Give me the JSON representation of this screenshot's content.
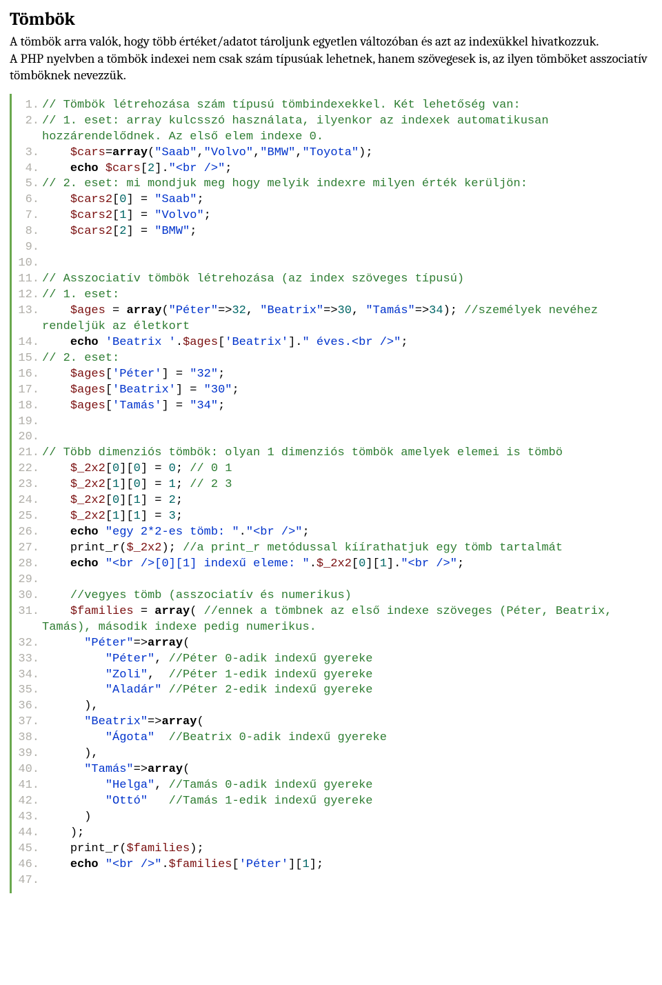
{
  "title": "Tömbök",
  "intro": [
    "A tömbök arra valók, hogy több értéket/adatot tároljunk egyetlen változóban és azt az indexükkel hivatkozzuk.",
    "A PHP nyelvben a tömbök indexei nem csak szám típusúak lehetnek, hanem szövegesek is, az ilyen tömböket asszociatív tömböknek nevezzük."
  ],
  "code": [
    {
      "n": "1.",
      "tokens": [
        {
          "c": "comment",
          "t": "// Tömbök létrehozása szám típusú tömbindexekkel. Két lehetőség van:"
        }
      ]
    },
    {
      "n": "2.",
      "tokens": [
        {
          "c": "comment",
          "t": "// 1. eset: array kulcsszó használata, ilyenkor az indexek automatikusan hozzárendelődnek. Az első elem indexe 0."
        }
      ]
    },
    {
      "n": "3.",
      "tokens": [
        {
          "c": "plain",
          "t": "    "
        },
        {
          "c": "var",
          "t": "$cars"
        },
        {
          "c": "op",
          "t": "="
        },
        {
          "c": "func",
          "t": "array"
        },
        {
          "c": "plain",
          "t": "("
        },
        {
          "c": "str",
          "t": "\"Saab\""
        },
        {
          "c": "plain",
          "t": ","
        },
        {
          "c": "str",
          "t": "\"Volvo\""
        },
        {
          "c": "plain",
          "t": ","
        },
        {
          "c": "str",
          "t": "\"BMW\""
        },
        {
          "c": "plain",
          "t": ","
        },
        {
          "c": "str",
          "t": "\"Toyota\""
        },
        {
          "c": "plain",
          "t": ");"
        }
      ]
    },
    {
      "n": "4.",
      "tokens": [
        {
          "c": "plain",
          "t": "    "
        },
        {
          "c": "keyword",
          "t": "echo"
        },
        {
          "c": "plain",
          "t": " "
        },
        {
          "c": "var",
          "t": "$cars"
        },
        {
          "c": "plain",
          "t": "["
        },
        {
          "c": "num",
          "t": "2"
        },
        {
          "c": "plain",
          "t": "]."
        },
        {
          "c": "str",
          "t": "\"<br />\""
        },
        {
          "c": "plain",
          "t": ";"
        }
      ]
    },
    {
      "n": "5.",
      "tokens": [
        {
          "c": "comment",
          "t": "// 2. eset: mi mondjuk meg hogy melyik indexre milyen érték kerüljön:"
        }
      ]
    },
    {
      "n": "6.",
      "tokens": [
        {
          "c": "plain",
          "t": "    "
        },
        {
          "c": "var",
          "t": "$cars2"
        },
        {
          "c": "plain",
          "t": "["
        },
        {
          "c": "num",
          "t": "0"
        },
        {
          "c": "plain",
          "t": "] = "
        },
        {
          "c": "str",
          "t": "\"Saab\""
        },
        {
          "c": "plain",
          "t": ";"
        }
      ]
    },
    {
      "n": "7.",
      "tokens": [
        {
          "c": "plain",
          "t": "    "
        },
        {
          "c": "var",
          "t": "$cars2"
        },
        {
          "c": "plain",
          "t": "["
        },
        {
          "c": "num",
          "t": "1"
        },
        {
          "c": "plain",
          "t": "] = "
        },
        {
          "c": "str",
          "t": "\"Volvo\""
        },
        {
          "c": "plain",
          "t": ";"
        }
      ]
    },
    {
      "n": "8.",
      "tokens": [
        {
          "c": "plain",
          "t": "    "
        },
        {
          "c": "var",
          "t": "$cars2"
        },
        {
          "c": "plain",
          "t": "["
        },
        {
          "c": "num",
          "t": "2"
        },
        {
          "c": "plain",
          "t": "] = "
        },
        {
          "c": "str",
          "t": "\"BMW\""
        },
        {
          "c": "plain",
          "t": ";"
        }
      ]
    },
    {
      "n": "9.",
      "tokens": [
        {
          "c": "plain",
          "t": " "
        }
      ]
    },
    {
      "n": "10.",
      "tokens": [
        {
          "c": "plain",
          "t": " "
        }
      ]
    },
    {
      "n": "11.",
      "tokens": [
        {
          "c": "comment",
          "t": "// Asszociatív tömbök létrehozása (az index szöveges típusú)"
        }
      ]
    },
    {
      "n": "12.",
      "tokens": [
        {
          "c": "comment",
          "t": "// 1. eset:"
        }
      ]
    },
    {
      "n": "13.",
      "tokens": [
        {
          "c": "plain",
          "t": "    "
        },
        {
          "c": "var",
          "t": "$ages"
        },
        {
          "c": "plain",
          "t": " = "
        },
        {
          "c": "func",
          "t": "array"
        },
        {
          "c": "plain",
          "t": "("
        },
        {
          "c": "str",
          "t": "\"Péter\""
        },
        {
          "c": "plain",
          "t": "=>"
        },
        {
          "c": "num",
          "t": "32"
        },
        {
          "c": "plain",
          "t": ", "
        },
        {
          "c": "str",
          "t": "\"Beatrix\""
        },
        {
          "c": "plain",
          "t": "=>"
        },
        {
          "c": "num",
          "t": "30"
        },
        {
          "c": "plain",
          "t": ", "
        },
        {
          "c": "str",
          "t": "\"Tamás\""
        },
        {
          "c": "plain",
          "t": "=>"
        },
        {
          "c": "num",
          "t": "34"
        },
        {
          "c": "plain",
          "t": "); "
        },
        {
          "c": "comment",
          "t": "//személyek nevéhez rendeljük az életkort"
        }
      ]
    },
    {
      "n": "14.",
      "tokens": [
        {
          "c": "plain",
          "t": "    "
        },
        {
          "c": "keyword",
          "t": "echo"
        },
        {
          "c": "plain",
          "t": " "
        },
        {
          "c": "str",
          "t": "'Beatrix '"
        },
        {
          "c": "plain",
          "t": "."
        },
        {
          "c": "var",
          "t": "$ages"
        },
        {
          "c": "plain",
          "t": "["
        },
        {
          "c": "str",
          "t": "'Beatrix'"
        },
        {
          "c": "plain",
          "t": "]."
        },
        {
          "c": "str",
          "t": "\" éves.<br />\""
        },
        {
          "c": "plain",
          "t": ";"
        }
      ]
    },
    {
      "n": "15.",
      "tokens": [
        {
          "c": "comment",
          "t": "// 2. eset:"
        }
      ]
    },
    {
      "n": "16.",
      "tokens": [
        {
          "c": "plain",
          "t": "    "
        },
        {
          "c": "var",
          "t": "$ages"
        },
        {
          "c": "plain",
          "t": "["
        },
        {
          "c": "str",
          "t": "'Péter'"
        },
        {
          "c": "plain",
          "t": "] = "
        },
        {
          "c": "str",
          "t": "\"32\""
        },
        {
          "c": "plain",
          "t": ";"
        }
      ]
    },
    {
      "n": "17.",
      "tokens": [
        {
          "c": "plain",
          "t": "    "
        },
        {
          "c": "var",
          "t": "$ages"
        },
        {
          "c": "plain",
          "t": "["
        },
        {
          "c": "str",
          "t": "'Beatrix'"
        },
        {
          "c": "plain",
          "t": "] = "
        },
        {
          "c": "str",
          "t": "\"30\""
        },
        {
          "c": "plain",
          "t": ";"
        }
      ]
    },
    {
      "n": "18.",
      "tokens": [
        {
          "c": "plain",
          "t": "    "
        },
        {
          "c": "var",
          "t": "$ages"
        },
        {
          "c": "plain",
          "t": "["
        },
        {
          "c": "str",
          "t": "'Tamás'"
        },
        {
          "c": "plain",
          "t": "] = "
        },
        {
          "c": "str",
          "t": "\"34\""
        },
        {
          "c": "plain",
          "t": ";"
        }
      ]
    },
    {
      "n": "19.",
      "tokens": [
        {
          "c": "plain",
          "t": " "
        }
      ]
    },
    {
      "n": "20.",
      "tokens": [
        {
          "c": "plain",
          "t": " "
        }
      ]
    },
    {
      "n": "21.",
      "tokens": [
        {
          "c": "comment",
          "t": "// Több dimenziós tömbök: olyan 1 dimenziós tömbök amelyek elemei is tömbö"
        }
      ]
    },
    {
      "n": "22.",
      "tokens": [
        {
          "c": "plain",
          "t": "    "
        },
        {
          "c": "var",
          "t": "$_2x2"
        },
        {
          "c": "plain",
          "t": "["
        },
        {
          "c": "num",
          "t": "0"
        },
        {
          "c": "plain",
          "t": "]["
        },
        {
          "c": "num",
          "t": "0"
        },
        {
          "c": "plain",
          "t": "] = "
        },
        {
          "c": "num",
          "t": "0"
        },
        {
          "c": "plain",
          "t": "; "
        },
        {
          "c": "comment",
          "t": "// 0 1"
        }
      ]
    },
    {
      "n": "23.",
      "tokens": [
        {
          "c": "plain",
          "t": "    "
        },
        {
          "c": "var",
          "t": "$_2x2"
        },
        {
          "c": "plain",
          "t": "["
        },
        {
          "c": "num",
          "t": "1"
        },
        {
          "c": "plain",
          "t": "]["
        },
        {
          "c": "num",
          "t": "0"
        },
        {
          "c": "plain",
          "t": "] = "
        },
        {
          "c": "num",
          "t": "1"
        },
        {
          "c": "plain",
          "t": "; "
        },
        {
          "c": "comment",
          "t": "// 2 3"
        }
      ]
    },
    {
      "n": "24.",
      "tokens": [
        {
          "c": "plain",
          "t": "    "
        },
        {
          "c": "var",
          "t": "$_2x2"
        },
        {
          "c": "plain",
          "t": "["
        },
        {
          "c": "num",
          "t": "0"
        },
        {
          "c": "plain",
          "t": "]["
        },
        {
          "c": "num",
          "t": "1"
        },
        {
          "c": "plain",
          "t": "] = "
        },
        {
          "c": "num",
          "t": "2"
        },
        {
          "c": "plain",
          "t": ";"
        }
      ]
    },
    {
      "n": "25.",
      "tokens": [
        {
          "c": "plain",
          "t": "    "
        },
        {
          "c": "var",
          "t": "$_2x2"
        },
        {
          "c": "plain",
          "t": "["
        },
        {
          "c": "num",
          "t": "1"
        },
        {
          "c": "plain",
          "t": "]["
        },
        {
          "c": "num",
          "t": "1"
        },
        {
          "c": "plain",
          "t": "] = "
        },
        {
          "c": "num",
          "t": "3"
        },
        {
          "c": "plain",
          "t": ";"
        }
      ]
    },
    {
      "n": "26.",
      "tokens": [
        {
          "c": "plain",
          "t": "    "
        },
        {
          "c": "keyword",
          "t": "echo"
        },
        {
          "c": "plain",
          "t": " "
        },
        {
          "c": "str",
          "t": "\"egy 2*2-es tömb: \""
        },
        {
          "c": "plain",
          "t": "."
        },
        {
          "c": "str",
          "t": "\"<br />\""
        },
        {
          "c": "plain",
          "t": ";"
        }
      ]
    },
    {
      "n": "27.",
      "tokens": [
        {
          "c": "plain",
          "t": "    print_r("
        },
        {
          "c": "var",
          "t": "$_2x2"
        },
        {
          "c": "plain",
          "t": "); "
        },
        {
          "c": "comment",
          "t": "//a print_r metódussal kíírathatjuk egy tömb tartalmát"
        }
      ]
    },
    {
      "n": "28.",
      "tokens": [
        {
          "c": "plain",
          "t": "    "
        },
        {
          "c": "keyword",
          "t": "echo"
        },
        {
          "c": "plain",
          "t": " "
        },
        {
          "c": "str",
          "t": "\"<br />[0][1] indexű eleme: \""
        },
        {
          "c": "plain",
          "t": "."
        },
        {
          "c": "var",
          "t": "$_2x2"
        },
        {
          "c": "plain",
          "t": "["
        },
        {
          "c": "num",
          "t": "0"
        },
        {
          "c": "plain",
          "t": "]["
        },
        {
          "c": "num",
          "t": "1"
        },
        {
          "c": "plain",
          "t": "]."
        },
        {
          "c": "str",
          "t": "\"<br />\""
        },
        {
          "c": "plain",
          "t": ";"
        }
      ]
    },
    {
      "n": "29.",
      "tokens": [
        {
          "c": "plain",
          "t": " "
        }
      ]
    },
    {
      "n": "30.",
      "tokens": [
        {
          "c": "plain",
          "t": "    "
        },
        {
          "c": "comment",
          "t": "//vegyes tömb (asszociatív és numerikus)"
        }
      ]
    },
    {
      "n": "31.",
      "tokens": [
        {
          "c": "plain",
          "t": "    "
        },
        {
          "c": "var",
          "t": "$families"
        },
        {
          "c": "plain",
          "t": " = "
        },
        {
          "c": "func",
          "t": "array"
        },
        {
          "c": "plain",
          "t": "( "
        },
        {
          "c": "comment",
          "t": "//ennek a tömbnek az első indexe szöveges (Péter, Beatrix, Tamás), második indexe pedig numerikus."
        }
      ]
    },
    {
      "n": "32.",
      "tokens": [
        {
          "c": "plain",
          "t": "      "
        },
        {
          "c": "str",
          "t": "\"Péter\""
        },
        {
          "c": "plain",
          "t": "=>"
        },
        {
          "c": "func",
          "t": "array"
        },
        {
          "c": "plain",
          "t": "("
        }
      ]
    },
    {
      "n": "33.",
      "tokens": [
        {
          "c": "plain",
          "t": "         "
        },
        {
          "c": "str",
          "t": "\"Péter\""
        },
        {
          "c": "plain",
          "t": ", "
        },
        {
          "c": "comment",
          "t": "//Péter 0-adik indexű gyereke"
        }
      ]
    },
    {
      "n": "34.",
      "tokens": [
        {
          "c": "plain",
          "t": "         "
        },
        {
          "c": "str",
          "t": "\"Zoli\""
        },
        {
          "c": "plain",
          "t": ",  "
        },
        {
          "c": "comment",
          "t": "//Péter 1-edik indexű gyereke"
        }
      ]
    },
    {
      "n": "35.",
      "tokens": [
        {
          "c": "plain",
          "t": "         "
        },
        {
          "c": "str",
          "t": "\"Aladár\""
        },
        {
          "c": "plain",
          "t": " "
        },
        {
          "c": "comment",
          "t": "//Péter 2-edik indexű gyereke"
        }
      ]
    },
    {
      "n": "36.",
      "tokens": [
        {
          "c": "plain",
          "t": "      ),"
        }
      ]
    },
    {
      "n": "37.",
      "tokens": [
        {
          "c": "plain",
          "t": "      "
        },
        {
          "c": "str",
          "t": "\"Beatrix\""
        },
        {
          "c": "plain",
          "t": "=>"
        },
        {
          "c": "func",
          "t": "array"
        },
        {
          "c": "plain",
          "t": "("
        }
      ]
    },
    {
      "n": "38.",
      "tokens": [
        {
          "c": "plain",
          "t": "         "
        },
        {
          "c": "str",
          "t": "\"Ágota\""
        },
        {
          "c": "plain",
          "t": "  "
        },
        {
          "c": "comment",
          "t": "//Beatrix 0-adik indexű gyereke"
        }
      ]
    },
    {
      "n": "39.",
      "tokens": [
        {
          "c": "plain",
          "t": "      ),"
        }
      ]
    },
    {
      "n": "40.",
      "tokens": [
        {
          "c": "plain",
          "t": "      "
        },
        {
          "c": "str",
          "t": "\"Tamás\""
        },
        {
          "c": "plain",
          "t": "=>"
        },
        {
          "c": "func",
          "t": "array"
        },
        {
          "c": "plain",
          "t": "("
        }
      ]
    },
    {
      "n": "41.",
      "tokens": [
        {
          "c": "plain",
          "t": "         "
        },
        {
          "c": "str",
          "t": "\"Helga\""
        },
        {
          "c": "plain",
          "t": ", "
        },
        {
          "c": "comment",
          "t": "//Tamás 0-adik indexű gyereke"
        }
      ]
    },
    {
      "n": "42.",
      "tokens": [
        {
          "c": "plain",
          "t": "         "
        },
        {
          "c": "str",
          "t": "\"Ottó\""
        },
        {
          "c": "plain",
          "t": "   "
        },
        {
          "c": "comment",
          "t": "//Tamás 1-edik indexű gyereke"
        }
      ]
    },
    {
      "n": "43.",
      "tokens": [
        {
          "c": "plain",
          "t": "      )"
        }
      ]
    },
    {
      "n": "44.",
      "tokens": [
        {
          "c": "plain",
          "t": "    );"
        }
      ]
    },
    {
      "n": "45.",
      "tokens": [
        {
          "c": "plain",
          "t": "    print_r("
        },
        {
          "c": "var",
          "t": "$families"
        },
        {
          "c": "plain",
          "t": ");"
        }
      ]
    },
    {
      "n": "46.",
      "tokens": [
        {
          "c": "plain",
          "t": "    "
        },
        {
          "c": "keyword",
          "t": "echo"
        },
        {
          "c": "plain",
          "t": " "
        },
        {
          "c": "str",
          "t": "\"<br />\""
        },
        {
          "c": "plain",
          "t": "."
        },
        {
          "c": "var",
          "t": "$families"
        },
        {
          "c": "plain",
          "t": "["
        },
        {
          "c": "str",
          "t": "'Péter'"
        },
        {
          "c": "plain",
          "t": "]["
        },
        {
          "c": "num",
          "t": "1"
        },
        {
          "c": "plain",
          "t": "];"
        }
      ]
    },
    {
      "n": "47.",
      "tokens": [
        {
          "c": "plain",
          "t": " "
        }
      ]
    }
  ]
}
